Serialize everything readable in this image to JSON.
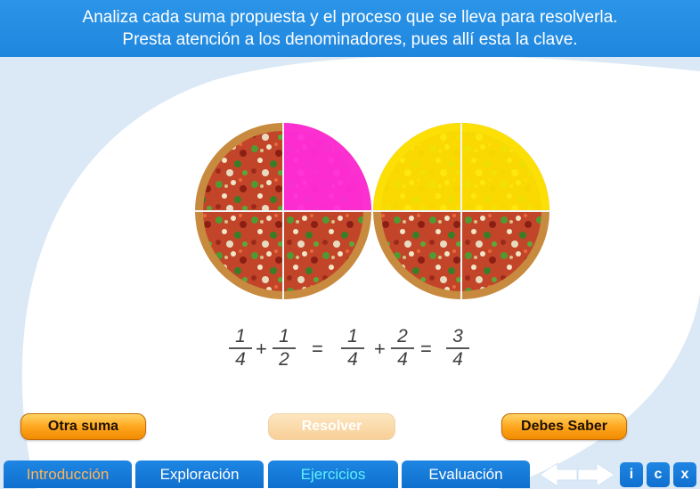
{
  "header": {
    "line1": "Analiza cada suma propuesta y el proceso que se lleva para resolverla.",
    "line2": "Presta atención a los denominadores, pues allí esta la clave."
  },
  "colors": {
    "header_blue": "#1f86de",
    "highlight_magenta": "#ff2bd9",
    "highlight_yellow": "#ffe600",
    "button_orange": "#ffa71f"
  },
  "pizzas": [
    {
      "shaded_quarters": 1,
      "total_quarters": 4,
      "shade_color": "magenta"
    },
    {
      "shaded_quarters": 2,
      "total_quarters": 4,
      "shade_color": "yellow"
    }
  ],
  "equation": {
    "f1": {
      "num": "1",
      "den": "4"
    },
    "op1": "+",
    "f2": {
      "num": "1",
      "den": "2"
    },
    "eq1": "=",
    "f3": {
      "num": "1",
      "den": "4"
    },
    "op2": "+",
    "f4": {
      "num": "2",
      "den": "4"
    },
    "eq2": "=",
    "f5": {
      "num": "3",
      "den": "4"
    }
  },
  "buttons": {
    "otra_suma": "Otra suma",
    "resolver": "Resolver",
    "debes_saber": "Debes Saber"
  },
  "nav": {
    "tabs": [
      "Introducción",
      "Exploración",
      "Ejercicios",
      "Evaluación"
    ],
    "info": "i",
    "credits": "c",
    "close": "x"
  }
}
